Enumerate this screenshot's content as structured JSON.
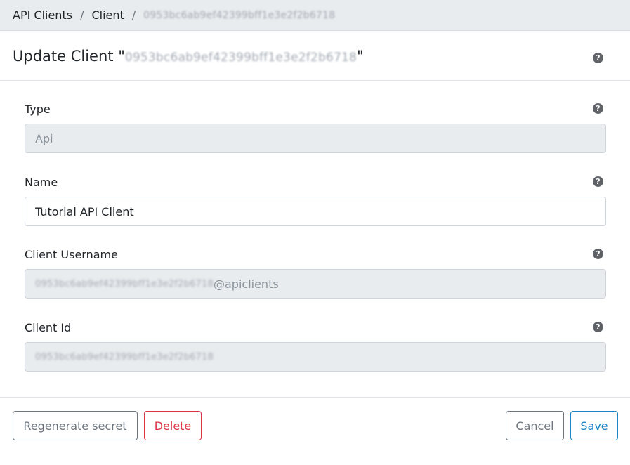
{
  "breadcrumb": {
    "items": [
      "API Clients",
      "Client"
    ],
    "separator": "/",
    "current": "0953bc6ab9ef42399bff1e3e2f2b6718"
  },
  "header": {
    "title_prefix": "Update Client \"",
    "client_id": "0953bc6ab9ef42399bff1e3e2f2b6718",
    "title_suffix": "\"",
    "help_icon": "?"
  },
  "fields": {
    "type": {
      "label": "Type",
      "value": "Api",
      "help_icon": "?"
    },
    "name": {
      "label": "Name",
      "value": "Tutorial API Client",
      "help_icon": "?"
    },
    "username": {
      "label": "Client Username",
      "value": "0953bc6ab9ef42399bff1e3e2f2b6718",
      "suffix": "@apiclients",
      "help_icon": "?"
    },
    "client_id": {
      "label": "Client Id",
      "value": "0953bc6ab9ef42399bff1e3e2f2b6718",
      "help_icon": "?"
    }
  },
  "buttons": {
    "regenerate": "Regenerate secret",
    "delete": "Delete",
    "cancel": "Cancel",
    "save": "Save"
  },
  "colors": {
    "primary": "#1a84c6",
    "danger": "#dc3545",
    "secondary": "#6c757d",
    "readonly_bg": "#e9ecef"
  }
}
